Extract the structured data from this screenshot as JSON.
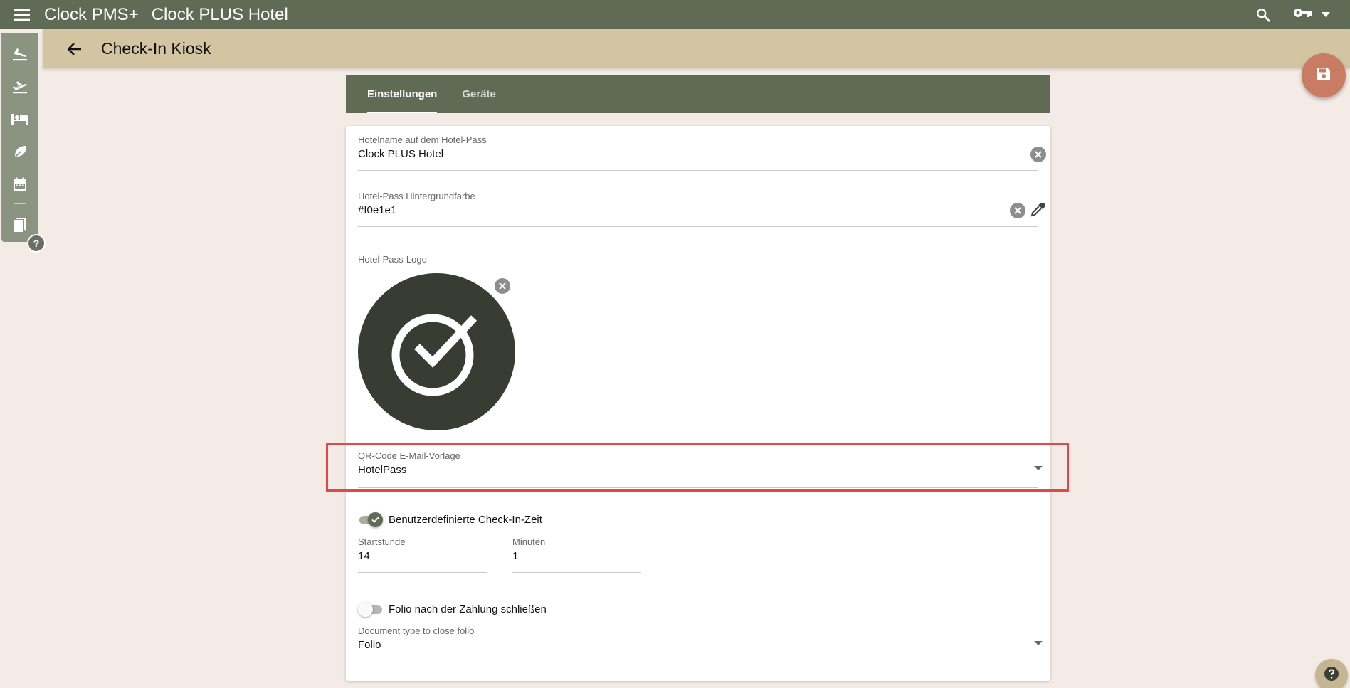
{
  "app": {
    "name": "Clock PMS+",
    "hotel": "Clock PLUS Hotel"
  },
  "header": {
    "title": "Check-In Kiosk"
  },
  "rail": {
    "items": [
      "arrivals-icon",
      "departures-icon",
      "rooms-icon",
      "housekeeping-icon",
      "calendar-icon",
      "bookmarks-icon"
    ],
    "help_label": "?"
  },
  "tabs": [
    {
      "label": "Einstellungen",
      "active": true
    },
    {
      "label": "Geräte",
      "active": false
    }
  ],
  "form": {
    "hotel_name": {
      "label": "Hotelname auf dem Hotel-Pass",
      "value": "Clock PLUS Hotel"
    },
    "bg_color": {
      "label": "Hotel-Pass Hintergrundfarbe",
      "value": "#f0e1e1"
    },
    "logo": {
      "label": "Hotel-Pass-Logo"
    },
    "qr_template": {
      "label": "QR-Code E-Mail-Vorlage",
      "value": "HotelPass"
    },
    "custom_checkin": {
      "label": "Benutzerdefinierte Check-In-Zeit",
      "enabled": true
    },
    "start_hour": {
      "label": "Startstunde",
      "value": "14"
    },
    "minutes": {
      "label": "Minuten",
      "value": "1"
    },
    "close_folio": {
      "label": "Folio nach der Zahlung schließen",
      "enabled": false
    },
    "doc_type": {
      "label": "Document type to close folio",
      "value": "Folio"
    }
  },
  "colors": {
    "topbar": "#5f6b55",
    "pagebar": "#d3c4a2",
    "save_fab": "#c97b64",
    "highlight": "#e0484a",
    "background": "#f4ebe6"
  }
}
